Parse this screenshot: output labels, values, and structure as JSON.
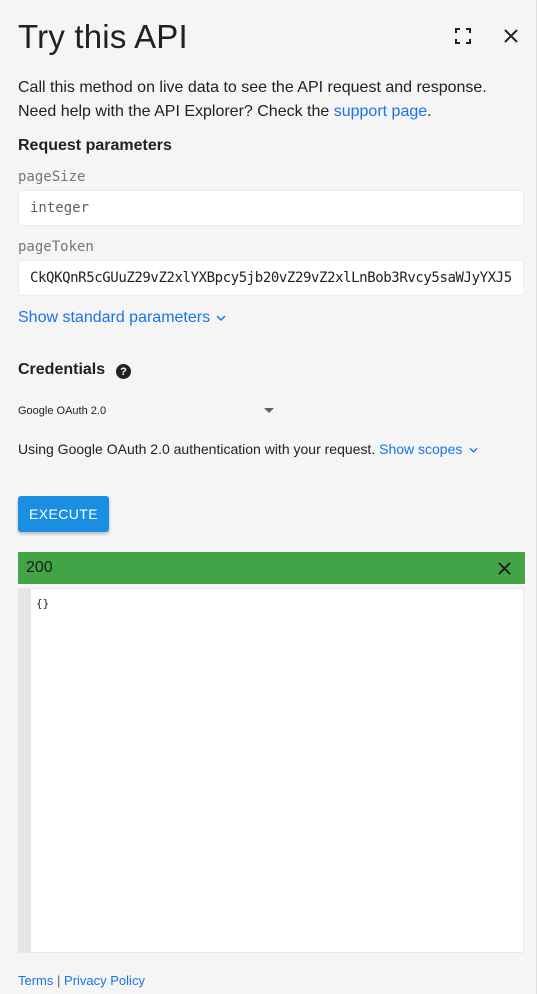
{
  "header": {
    "title": "Try this API",
    "fullscreen_icon": "fullscreen-icon",
    "close_icon": "close-icon"
  },
  "intro": {
    "text1": "Call this method on live data to see the API request and response. Need help with the API Explorer? Check the ",
    "link": "support page",
    "text2": "."
  },
  "request_parameters": {
    "heading": "Request parameters",
    "params": [
      {
        "label": "pageSize",
        "value": "",
        "placeholder": "integer"
      },
      {
        "label": "pageToken",
        "value": "CkQKQnR5cGUuZ29vZ2xlYXBpcy5jb20vZ29vZ2xlLnBob3Rvcy5saWJyYXJ5",
        "placeholder": ""
      }
    ],
    "show_standard": "Show standard parameters"
  },
  "credentials": {
    "heading": "Credentials",
    "help_icon": "help-icon",
    "selected": "Google OAuth 2.0",
    "auth_text": "Using Google OAuth 2.0 authentication with your request.",
    "show_scopes": "Show scopes"
  },
  "execute_label": "EXECUTE",
  "response": {
    "status": "200",
    "status_color": "#43a447",
    "body": "{}"
  },
  "footer": {
    "terms": "Terms",
    "separator": "|",
    "privacy": "Privacy Policy"
  },
  "colors": {
    "accent": "#1a73e8",
    "button": "#1a8ee1",
    "background": "#f5f5f5"
  }
}
